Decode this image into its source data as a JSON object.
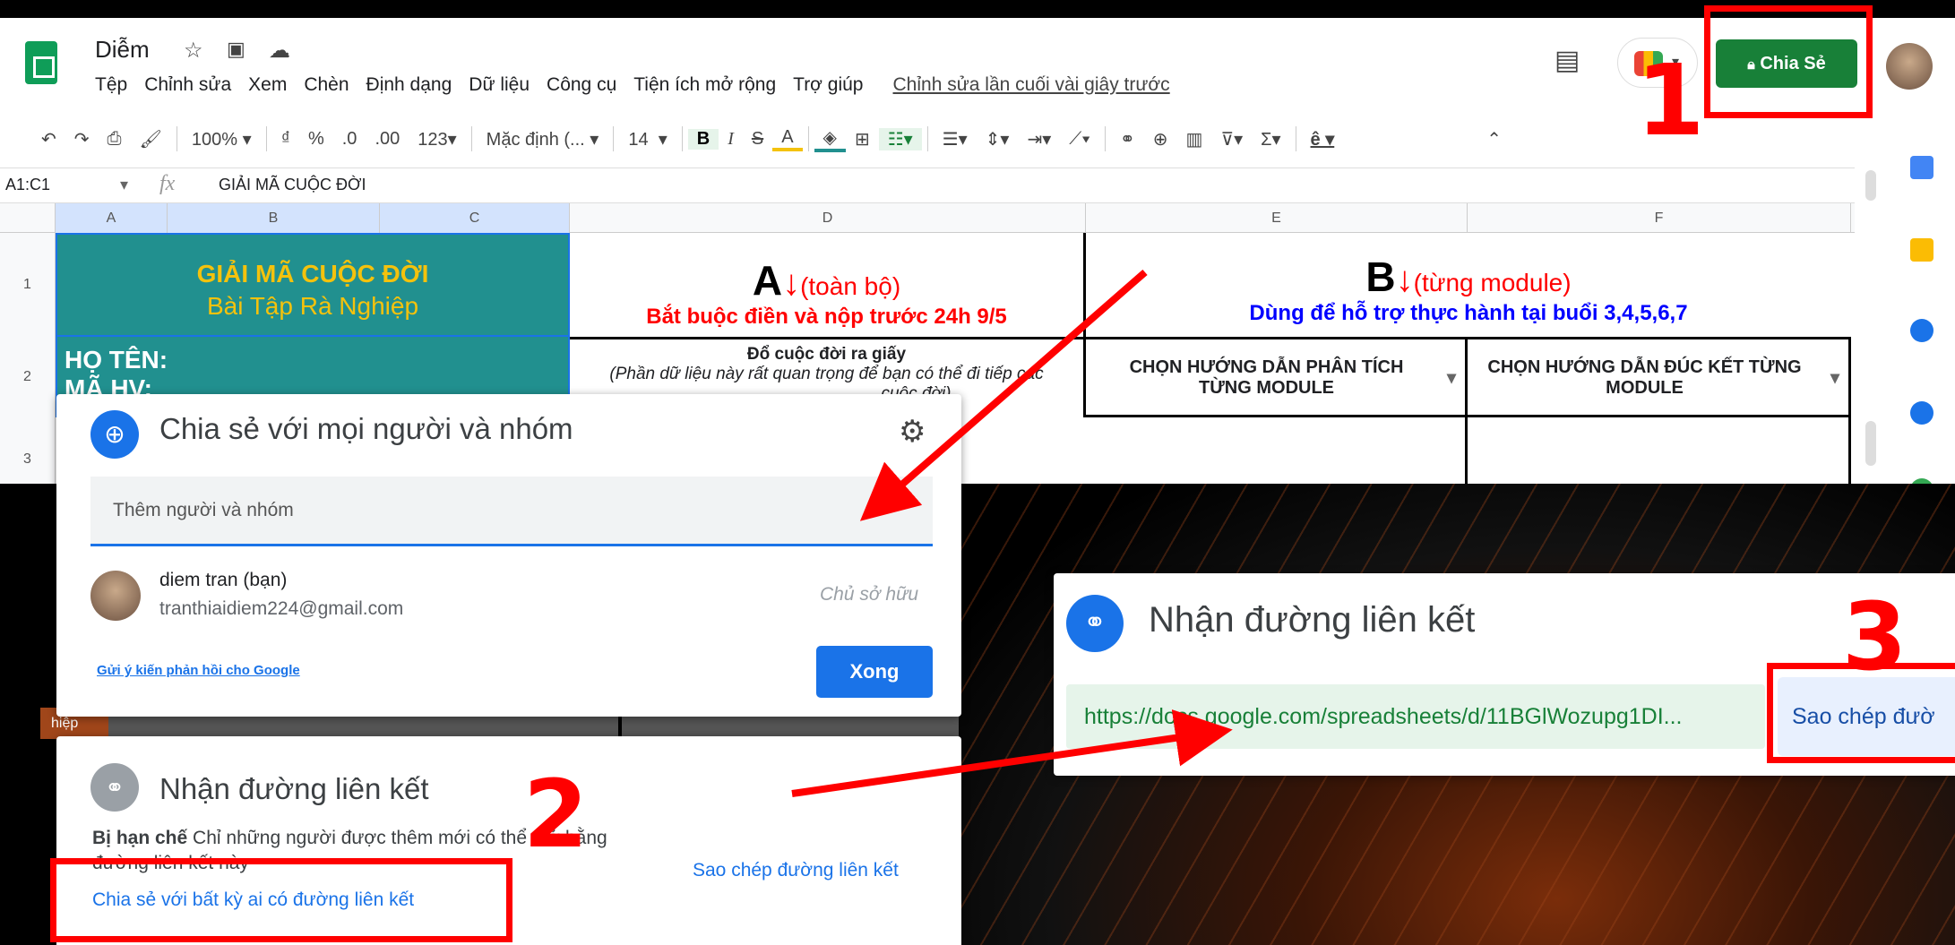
{
  "doc": {
    "title": "Diễm"
  },
  "menu": [
    "Tệp",
    "Chỉnh sửa",
    "Xem",
    "Chèn",
    "Định dạng",
    "Dữ liệu",
    "Công cụ",
    "Tiện ích mở rộng",
    "Trợ giúp"
  ],
  "last_edit": "Chỉnh sửa lần cuối vài giây trước",
  "share_button": "Chia Sẻ",
  "toolbar": {
    "zoom": "100%",
    "currency": "₫",
    "percent": "%",
    "dec_less": ".0",
    "dec_more": ".00",
    "format": "123",
    "font": "Mặc định (...",
    "size": "14"
  },
  "formula": {
    "cell_ref": "A1:C1",
    "fx": "fx",
    "value": "GIẢI MÃ CUỘC ĐỜI"
  },
  "columns": [
    "A",
    "B",
    "C",
    "D",
    "E",
    "F"
  ],
  "rows": [
    "1",
    "2",
    "3"
  ],
  "cells": {
    "a1_title": "GIẢI MÃ CUỘC ĐỜI",
    "a1_sub": "Bài Tập Rà Nghiệp",
    "d1_big": "A",
    "d1_arrow": "↓",
    "d1_label": "(toàn bộ)",
    "d1_note": "Bắt buộc điền và nộp trước 24h 9/5",
    "e1_big": "B",
    "e1_arrow": "↓",
    "e1_label": "(từng module)",
    "e1_note": "Dùng để hỗ trợ thực hành tại buổi 3,4,5,6,7",
    "a2_name": "HỌ TÊN:",
    "a2_id": "MÃ HV:",
    "d2_title": "Đổ cuộc đời ra giấy",
    "d2_note": "(Phần dữ liệu này rất quan trọng để bạn có thể đi tiếp các",
    "d2_note2": "cuộc đời)",
    "e2": "CHỌN HƯỚNG DẪN PHÂN TÍCH TỪNG MODULE",
    "f2": "CHỌN HƯỚNG DẪN ĐÚC KẾT TỪNG MODULE",
    "behind_text": "hiệp"
  },
  "share_dialog": {
    "title": "Chia sẻ với mọi người và nhóm",
    "input_placeholder": "Thêm người và nhóm",
    "user_name": "diem tran (bạn)",
    "user_email": "tranthiaidiem224@gmail.com",
    "role": "Chủ sở hữu",
    "feedback": "Gửi ý kiến phản hồi cho Google",
    "done": "Xong"
  },
  "link_dialog": {
    "title": "Nhận đường liên kết",
    "restricted": "Bị hạn chế",
    "restricted_desc": "Chỉ những người được thêm mới có thể mở bằng",
    "restricted_desc2": "đường liên kết này",
    "share_anyone": "Chia sẻ với bất kỳ ai có đường liên kết",
    "copy_link": "Sao chép đường liên kết"
  },
  "link_dialog_zoom": {
    "title": "Nhận đường liên kết",
    "url": "https://docs.google.com/spreadsheets/d/11BGlWozupg1DI...",
    "copy": "Sao chép đườ"
  },
  "steps": [
    "1",
    "2",
    "3"
  ],
  "colors": {
    "accent": "#1a73e8",
    "green": "#188038",
    "teal": "#21908f",
    "red": "#ff0000",
    "gold": "#f4c20d"
  }
}
